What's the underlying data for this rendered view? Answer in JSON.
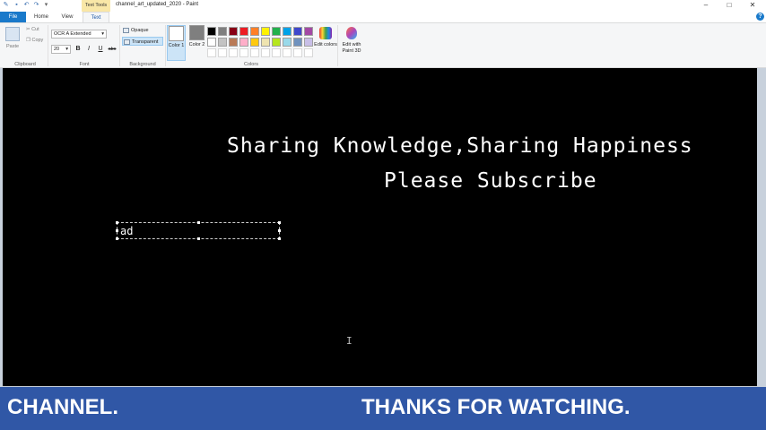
{
  "window": {
    "title": "channel_art_updated_2020 - Paint",
    "context_tab": "Text Tools",
    "minimize_glyph": "–",
    "maximize_glyph": "□",
    "close_glyph": "✕"
  },
  "tabs": {
    "file": "File",
    "home": "Home",
    "view": "View",
    "text": "Text"
  },
  "ribbon": {
    "clipboard": {
      "paste": "Paste",
      "cut": "Cut",
      "copy": "Copy",
      "label": "Clipboard"
    },
    "font": {
      "family": "OCR A Extended",
      "size": "20",
      "bold": "B",
      "italic": "I",
      "underline": "U",
      "strike": "abc",
      "label": "Font"
    },
    "background": {
      "opaque": "Opaque",
      "transparent": "Transparent",
      "label": "Background"
    },
    "colors": {
      "color1": "Color 1",
      "color2": "Color 2",
      "edit_colors": "Edit colors",
      "paint3d": "Edit with Paint 3D",
      "label": "Colors",
      "color1_value": "#ffffff",
      "color2_value": "#7f7f7f",
      "palette_row1": [
        "#000000",
        "#7f7f7f",
        "#880015",
        "#ed1c24",
        "#ff7f27",
        "#fff200",
        "#22b14c",
        "#00a2e8",
        "#3f48cc",
        "#a349a4"
      ],
      "palette_row2": [
        "#ffffff",
        "#c3c3c3",
        "#b97a57",
        "#ffaec9",
        "#ffc90e",
        "#efe4b0",
        "#b5e61d",
        "#99d9ea",
        "#7092be",
        "#c8bfe7"
      ]
    }
  },
  "canvas": {
    "line1": "Sharing Knowledge,Sharing Happiness",
    "line2": "Please Subscribe",
    "textbox_value": "ad",
    "background": "#000000"
  },
  "banner": {
    "left_text": "CHANNEL.",
    "right_text": "THANKS FOR WATCHING.",
    "color": "#3057a6"
  }
}
